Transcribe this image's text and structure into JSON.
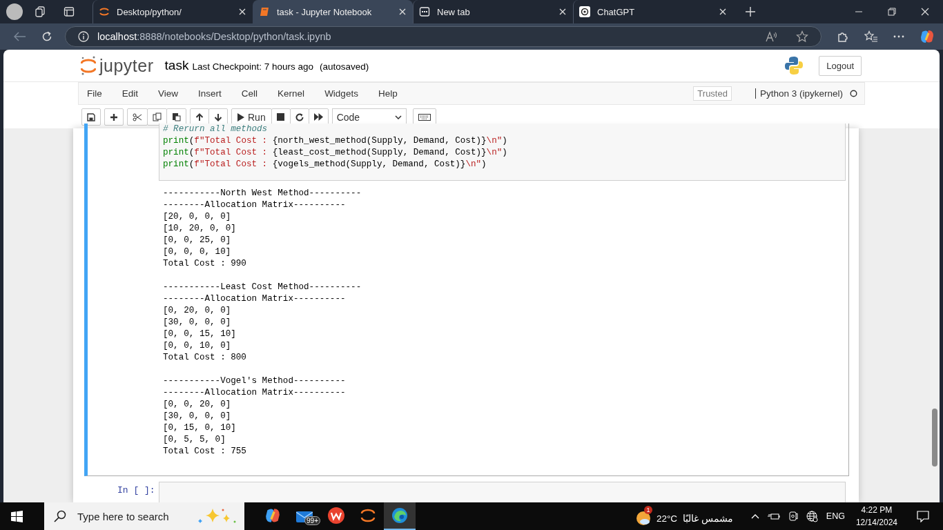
{
  "browser": {
    "tabs": [
      {
        "title": "Desktop/python/",
        "kind": "jupyter",
        "selected": false
      },
      {
        "title": "task - Jupyter Notebook",
        "kind": "notebook",
        "selected": true
      },
      {
        "title": "New tab",
        "kind": "newtab",
        "selected": false
      },
      {
        "title": "ChatGPT",
        "kind": "chatgpt",
        "selected": false
      }
    ],
    "address": {
      "host": "localhost",
      "rest": ":8888/notebooks/Desktop/python/task.ipynb"
    }
  },
  "notebook": {
    "name": "task",
    "checkpoint": "Last Checkpoint: 7 hours ago",
    "autosaved": "(autosaved)",
    "logout": "Logout",
    "menu": [
      "File",
      "Edit",
      "View",
      "Insert",
      "Cell",
      "Kernel",
      "Widgets",
      "Help"
    ],
    "trusted": "Trusted",
    "kernel": "Python 3 (ipykernel)",
    "run": "Run",
    "cell_type": "Code"
  },
  "cell": {
    "code": [
      [
        {
          "kind": "comment",
          "text": "# Rerurn all methods"
        }
      ],
      [
        {
          "kind": "builtin",
          "text": "print"
        },
        {
          "kind": "plain",
          "text": "("
        },
        {
          "kind": "string",
          "text": "f\"Total Cost : "
        },
        {
          "kind": "plain",
          "text": "{north_west_method(Supply, Demand, Cost)}"
        },
        {
          "kind": "string",
          "text": "\\n\""
        },
        {
          "kind": "plain",
          "text": ")"
        }
      ],
      [
        {
          "kind": "builtin",
          "text": "print"
        },
        {
          "kind": "plain",
          "text": "("
        },
        {
          "kind": "string",
          "text": "f\"Total Cost : "
        },
        {
          "kind": "plain",
          "text": "{least_cost_method(Supply, Demand, Cost)}"
        },
        {
          "kind": "string",
          "text": "\\n\""
        },
        {
          "kind": "plain",
          "text": ")"
        }
      ],
      [
        {
          "kind": "builtin",
          "text": "print"
        },
        {
          "kind": "plain",
          "text": "("
        },
        {
          "kind": "string",
          "text": "f\"Total Cost : "
        },
        {
          "kind": "plain",
          "text": "{vogels_method(Supply, Demand, Cost)}"
        },
        {
          "kind": "string",
          "text": "\\n\""
        },
        {
          "kind": "plain",
          "text": ")"
        }
      ]
    ],
    "output": [
      [
        "-----------North West Method----------",
        "--------Allocation Matrix----------",
        "[20, 0, 0, 0]",
        "[10, 20, 0, 0]",
        "[0, 0, 25, 0]",
        "[0, 0, 0, 10]",
        "Total Cost : 990"
      ],
      [
        "-----------Least Cost Method----------",
        "--------Allocation Matrix----------",
        "[0, 20, 0, 0]",
        "[30, 0, 0, 0]",
        "[0, 0, 15, 10]",
        "[0, 0, 10, 0]",
        "Total Cost : 800"
      ],
      [
        "-----------Vogel's Method----------",
        "--------Allocation Matrix----------",
        "[0, 0, 20, 0]",
        "[30, 0, 0, 0]",
        "[0, 15, 0, 10]",
        "[0, 5, 5, 0]",
        "Total Cost : 755"
      ]
    ]
  },
  "next_prompt": "In [ ]:",
  "taskbar": {
    "search": "Type here to search",
    "apps": [
      {
        "kind": "copilot",
        "selected": false
      },
      {
        "kind": "mail",
        "badge": "99+",
        "selected": false
      },
      {
        "kind": "wps",
        "selected": false
      },
      {
        "kind": "jupyter",
        "selected": false
      },
      {
        "kind": "edge",
        "selected": true
      }
    ],
    "weather": {
      "badge": "1",
      "temp": "22°C",
      "condition": "مشمس غالبًا"
    },
    "lang": "ENG",
    "time": "4:22 PM",
    "date": "12/14/2024"
  }
}
